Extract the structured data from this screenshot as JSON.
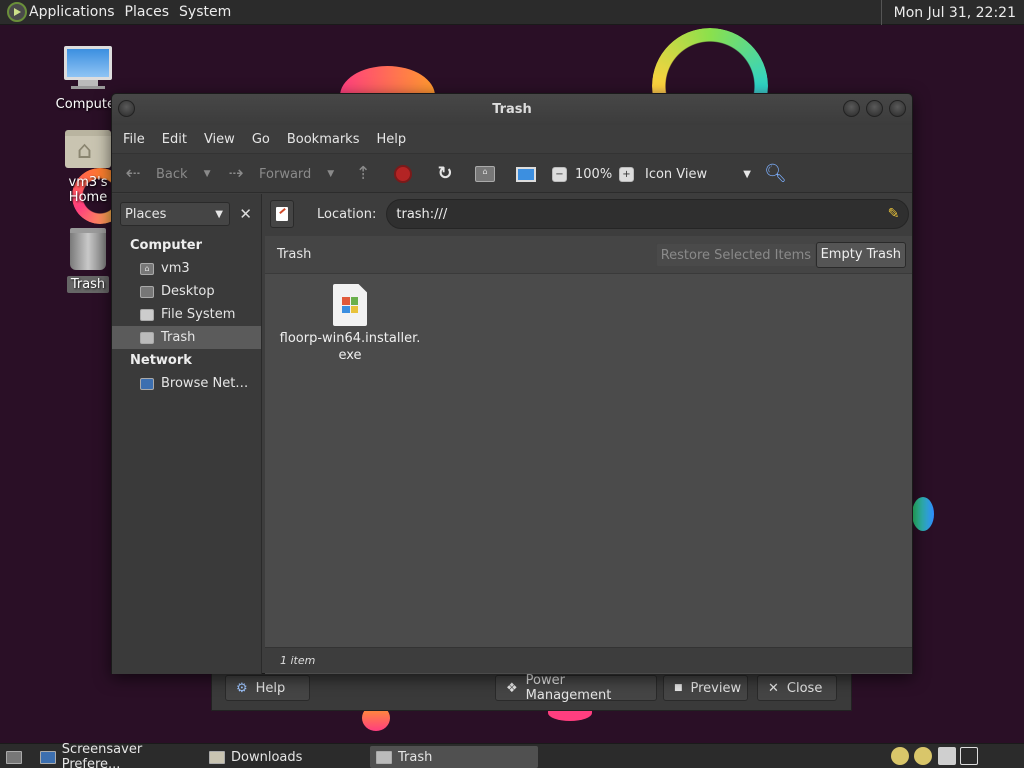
{
  "top_panel": {
    "menus": [
      "Applications",
      "Places",
      "System"
    ],
    "clock": "Mon Jul 31, 22:21"
  },
  "desktop": {
    "icons": [
      {
        "label": "Computer"
      },
      {
        "label": "vm3's Home"
      },
      {
        "label": "Trash"
      }
    ]
  },
  "window": {
    "title": "Trash",
    "menubar": [
      "File",
      "Edit",
      "View",
      "Go",
      "Bookmarks",
      "Help"
    ],
    "toolbar": {
      "back": "Back",
      "forward": "Forward",
      "zoom": "100%",
      "view_mode": "Icon View"
    },
    "sidebar": {
      "selector": "Places",
      "sections": [
        {
          "title": "Computer",
          "items": [
            "vm3",
            "Desktop",
            "File System",
            "Trash"
          ]
        },
        {
          "title": "Network",
          "items": [
            "Browse Net…"
          ]
        }
      ],
      "selected": "Trash"
    },
    "location": {
      "label": "Location:",
      "value": "trash:///"
    },
    "trash_bar": {
      "title": "Trash",
      "restore": "Restore Selected Items",
      "empty": "Empty Trash"
    },
    "files": [
      {
        "name_line1": "floorp-win64.installer.",
        "name_line2": "exe"
      }
    ],
    "status": "1 item"
  },
  "background_dialog": {
    "help": "Help",
    "power": "Power Management",
    "preview": "Preview",
    "close": "Close"
  },
  "bottom_panel": {
    "tasks": [
      "Screensaver Prefere...",
      "Downloads",
      "Trash"
    ],
    "active_task": "Trash"
  }
}
